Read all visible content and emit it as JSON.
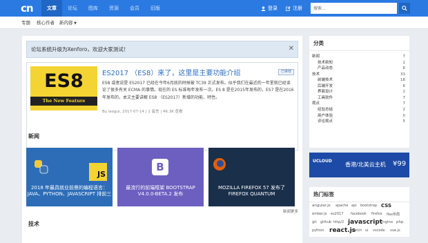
{
  "nav": {
    "logo": "cn",
    "items": [
      "文章",
      "论坛",
      "图库",
      "资源",
      "会员",
      "旧版"
    ],
    "login": "登录",
    "register": "注册",
    "search_placeholder": "搜索..."
  },
  "subnav": {
    "items": [
      "专题",
      "核心作者",
      "新内容"
    ]
  },
  "notice": {
    "text": "论坛系统升级为Xenforo，欢迎大家测试！"
  },
  "featured": {
    "image_title": "ES8",
    "image_subtitle": "The New Feature",
    "title": "ES2017 （ES8）来了，这里是主要功能介绍",
    "badge": "已推荐",
    "summary": "ES8 或者说是 ES2017 已经在今年6月底的时候被 TC39 正式发布。似乎我们在最近的一年里就已经谈论了很多有关 ECMA 的事情。现在的 ES 标准每年发布一次。ES 8 是在2015年发布的，ES7 是在2016年发布的，本文主要讲解 ES8 （ES2017）新增的功能、特性。",
    "meta": "By laogui, 2017-07-14 | 1 留言 | 46.3K 查看"
  },
  "news": {
    "title": "新闻",
    "cards": [
      {
        "caption": "2018 年最具就业前景的编程语言：JAVA、PYTHON、JAVASCRIPT 排前三",
        "color": "#2d6db8"
      },
      {
        "caption": "最流行的前端框架 BOOTSTRAP V4.0.0-BETA.2 发布",
        "color": "#6c5fc0"
      },
      {
        "caption": "MOZILLA FIREFOX 57 发布了 FIREFOX QUANTUM",
        "color": "#1a2f4a"
      }
    ],
    "more": "新闻更多"
  },
  "tech": {
    "title": "技术"
  },
  "sidebar": {
    "categories_title": "分类",
    "categories": [
      {
        "label": "新闻",
        "count": "7",
        "sub": false
      },
      {
        "label": "技术新知",
        "count": "1",
        "sub": true
      },
      {
        "label": "产品动态",
        "count": "6",
        "sub": true
      },
      {
        "label": "技术",
        "count": "33",
        "sub": false
      },
      {
        "label": "前端技术",
        "count": "18",
        "sub": true
      },
      {
        "label": "后端开发",
        "count": "6",
        "sub": true
      },
      {
        "label": "界面设计",
        "count": "2",
        "sub": true
      },
      {
        "label": "工具软件",
        "count": "7",
        "sub": true
      },
      {
        "label": "观点",
        "count": "7",
        "sub": false
      },
      {
        "label": "经验总结",
        "count": "2",
        "sub": true
      },
      {
        "label": "用户体验",
        "count": "0",
        "sub": true
      },
      {
        "label": "评论观点",
        "count": "5",
        "sub": true
      }
    ],
    "ad": {
      "brand": "UCLOUD",
      "text": "香港/北美云主机",
      "price": "¥99"
    },
    "tags_title": "热门标签",
    "tags": [
      "angular.js",
      "apache",
      "api",
      "bootstrap",
      "CSS",
      "ember.js",
      "es2017",
      "facebook",
      "firefox",
      "flex布局",
      "git",
      "github",
      "http/2",
      "javascript",
      "nginx",
      "php",
      "python",
      "react.js",
      "sketch",
      "ui",
      "vscode",
      "vue.js"
    ]
  },
  "colors": {
    "primary": "#2a7ae2",
    "primary_dark": "#1f66c5",
    "link": "#2a6fc4",
    "es8_yellow": "#f4d433"
  }
}
